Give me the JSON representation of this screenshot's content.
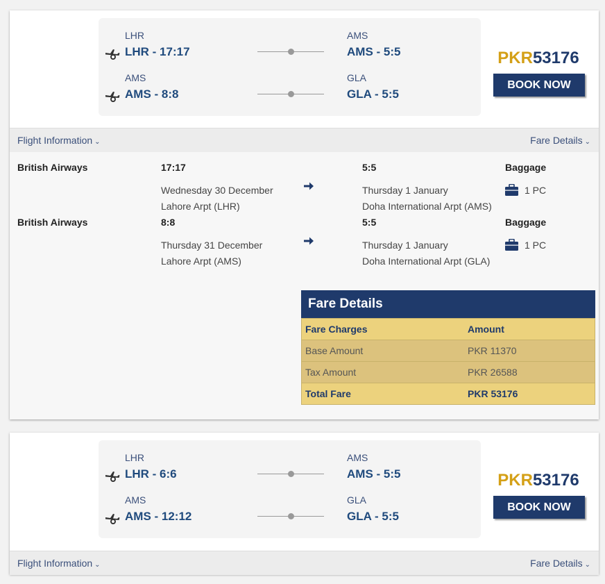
{
  "colors": {
    "navy": "#1f3a6b",
    "gold": "#d4a017",
    "fare_bg": "#ecd27d"
  },
  "icons": {
    "plane": "plane-takeoff-icon",
    "arrow": "arrow-right-icon",
    "baggage": "suitcase-icon"
  },
  "results": [
    {
      "legs": [
        {
          "dep_code": "LHR",
          "dep_time": "LHR - 17:17",
          "arr_code": "AMS",
          "arr_time": "AMS - 5:5"
        },
        {
          "dep_code": "AMS",
          "dep_time": "AMS - 8:8",
          "arr_code": "GLA",
          "arr_time": "GLA - 5:5"
        }
      ],
      "price_currency": "PKR",
      "price_amount": "53176",
      "book_label": "BOOK NOW",
      "flight_info_label": "Flight Information",
      "fare_details_label": "Fare Details",
      "segments": [
        {
          "airline": "British Airways",
          "dep_time": "17:17",
          "dep_date": "Wednesday 30 December",
          "dep_airport": "Lahore Arpt (LHR)",
          "arr_time": "5:5",
          "arr_date": "Thursday 1 January",
          "arr_airport": "Doha International Arpt (AMS)",
          "baggage_label": "Baggage",
          "baggage_value": "1 PC"
        },
        {
          "airline": "British Airways",
          "dep_time": "8:8",
          "dep_date": "Thursday 31 December",
          "dep_airport": "Lahore Arpt (AMS)",
          "arr_time": "5:5",
          "arr_date": "Thursday 1 January",
          "arr_airport": "Doha International Arpt (GLA)",
          "baggage_label": "Baggage",
          "baggage_value": "1 PC"
        }
      ],
      "fare_table": {
        "title": "Fare Details",
        "col_charges": "Fare Charges",
        "col_amount": "Amount",
        "rows": [
          {
            "label": "Base Amount",
            "value": "PKR 11370"
          },
          {
            "label": "Tax Amount",
            "value": "PKR 26588"
          }
        ],
        "total_label": "Total Fare",
        "total_value": "PKR 53176"
      }
    },
    {
      "legs": [
        {
          "dep_code": "LHR",
          "dep_time": "LHR - 6:6",
          "arr_code": "AMS",
          "arr_time": "AMS - 5:5"
        },
        {
          "dep_code": "AMS",
          "dep_time": "AMS - 12:12",
          "arr_code": "GLA",
          "arr_time": "GLA - 5:5"
        }
      ],
      "price_currency": "PKR",
      "price_amount": "53176",
      "book_label": "BOOK NOW",
      "flight_info_label": "Flight Information",
      "fare_details_label": "Fare Details"
    }
  ]
}
